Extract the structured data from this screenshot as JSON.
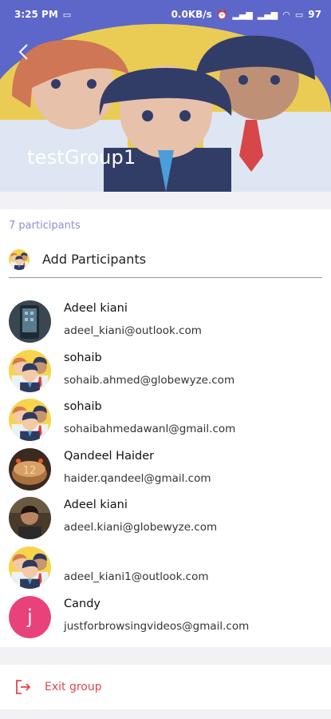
{
  "status_bar": {
    "time": "3:25 PM",
    "network_speed": "0.0KB/s",
    "battery": "97"
  },
  "header": {
    "group_name": "testGroup1"
  },
  "participants": {
    "count_label": "7 participants",
    "add_label": "Add Participants",
    "items": [
      {
        "name": "Adeel kiani",
        "email": "adeel_kiani@outlook.com",
        "avatar": "photo-phone"
      },
      {
        "name": "sohaib",
        "email": "sohaib.ahmed@globewyze.com",
        "avatar": "group-illustration"
      },
      {
        "name": "sohaib",
        "email": "sohaibahmedawanl@gmail.com",
        "avatar": "group-illustration"
      },
      {
        "name": "Qandeel Haider",
        "email": "haider.qandeel@gmail.com",
        "avatar": "photo-cake"
      },
      {
        "name": "Adeel kiani",
        "email": "adeel.kiani@globewyze.com",
        "avatar": "photo-person"
      },
      {
        "name": "",
        "email": "adeel_kiani1@outlook.com",
        "avatar": "group-illustration"
      },
      {
        "name": "Candy",
        "email": "justforbrowsingvideos@gmail.com",
        "avatar_letter": "j",
        "avatar_color": "#e9427b"
      }
    ]
  },
  "exit": {
    "label": "Exit group"
  },
  "colors": {
    "header_bg": "#5d68c9",
    "accent": "#8c8fd0",
    "danger": "#e0474c"
  }
}
